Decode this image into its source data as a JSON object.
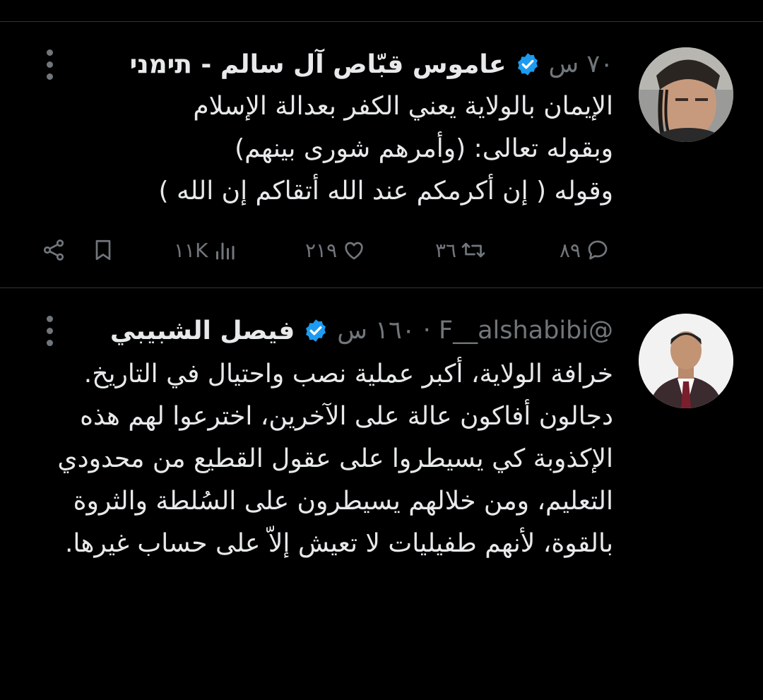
{
  "tweets": [
    {
      "name": "عاموس قبّاص آل سالم - תימני",
      "meta": "٧٠ س",
      "text": "الإيمان بالولاية يعني الكفر بعدالة الإسلام\nوبقوله تعالى: (وأمرهم شورى بينهم)\nوقوله ( إن أكرمكم عند الله أتقاكم إن الله )",
      "actions": {
        "replies": "٨٩",
        "retweets": "٣٦",
        "likes": "٢١٩",
        "views": "١١K"
      }
    },
    {
      "name": "فيصل الشبيبي",
      "meta": "@F__alshabibi · ١٦٠ س",
      "text": "خرافة الولاية، أكبر عملية نصب واحتيال في التاريخ.\nدجالون أفاكون عالة على الآخرين، اخترعوا لهم هذه الإكذوبة كي يسيطروا على عقول القطيع من محدودي التعليم، ومن خلالهم يسيطرون على السُلطة والثروة بالقوة، لأنهم طفيليات لا تعيش إلاّ على حساب غيرها."
    }
  ],
  "colors": {
    "background": "#000000",
    "text": "#e7e9ea",
    "muted": "#71767b",
    "verified": "#1d9bf0",
    "divider": "#2f3336"
  },
  "icons": [
    "more-icon",
    "verified-badge-icon",
    "reply-icon",
    "retweet-icon",
    "like-icon",
    "views-icon",
    "bookmark-icon",
    "share-icon"
  ]
}
